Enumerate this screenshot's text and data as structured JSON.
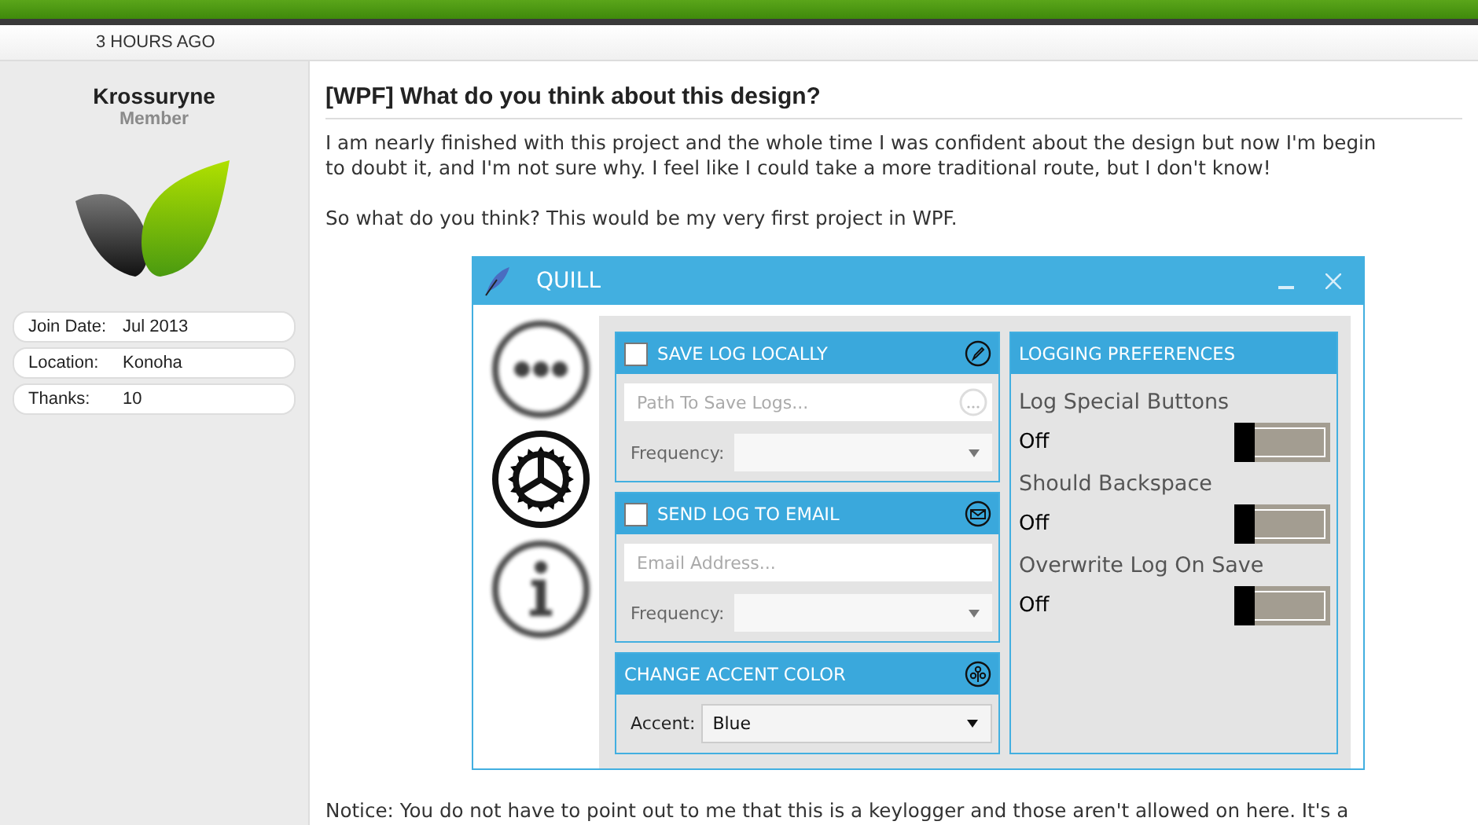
{
  "top_bar": {
    "timestamp": "3 HOURS AGO"
  },
  "user": {
    "name": "Krossuryne",
    "rank": "Member",
    "info": [
      {
        "label": "Join Date:",
        "value": "Jul 2013"
      },
      {
        "label": "Location:",
        "value": "Konoha"
      },
      {
        "label": "Thanks:",
        "value": "10"
      }
    ]
  },
  "post": {
    "title": "[WPF] What do you think about this design?",
    "lines": [
      "I am nearly finished with this project and the whole time I was confident about the design but now I'm begin",
      "to doubt it, and I'm not sure why. I feel like I could take a more traditional route, but I don't know!"
    ],
    "paragraph_2": "So what do you think? This would be my very first project in WPF.",
    "notice": "Notice: You do not have to point out to me that this is a keylogger and those aren't allowed on here. It's a"
  },
  "app_window": {
    "title": "QUILL",
    "nav": [
      {
        "kind": "more",
        "selected": false
      },
      {
        "kind": "settings",
        "selected": true
      },
      {
        "kind": "info",
        "selected": false
      }
    ],
    "sections": [
      {
        "kind": "local",
        "title": "SAVE LOG LOCALLY",
        "checked": false,
        "placeholder": "Path To Save Logs...",
        "frequency_label": "Frequency:"
      },
      {
        "kind": "email",
        "title": "SEND LOG TO EMAIL",
        "checked": false,
        "placeholder": "Email Address...",
        "frequency_label": "Frequency:"
      }
    ],
    "accent": {
      "title": "CHANGE ACCENT COLOR",
      "label": "Accent:",
      "value": "Blue"
    },
    "preferences": {
      "title": "LOGGING PREFERENCES",
      "items": [
        {
          "label": "Log Special Buttons",
          "state": "Off",
          "on": false
        },
        {
          "label": "Should Backspace",
          "state": "Off",
          "on": false
        },
        {
          "label": "Overwrite Log On Save",
          "state": "Off",
          "on": false
        }
      ]
    }
  }
}
